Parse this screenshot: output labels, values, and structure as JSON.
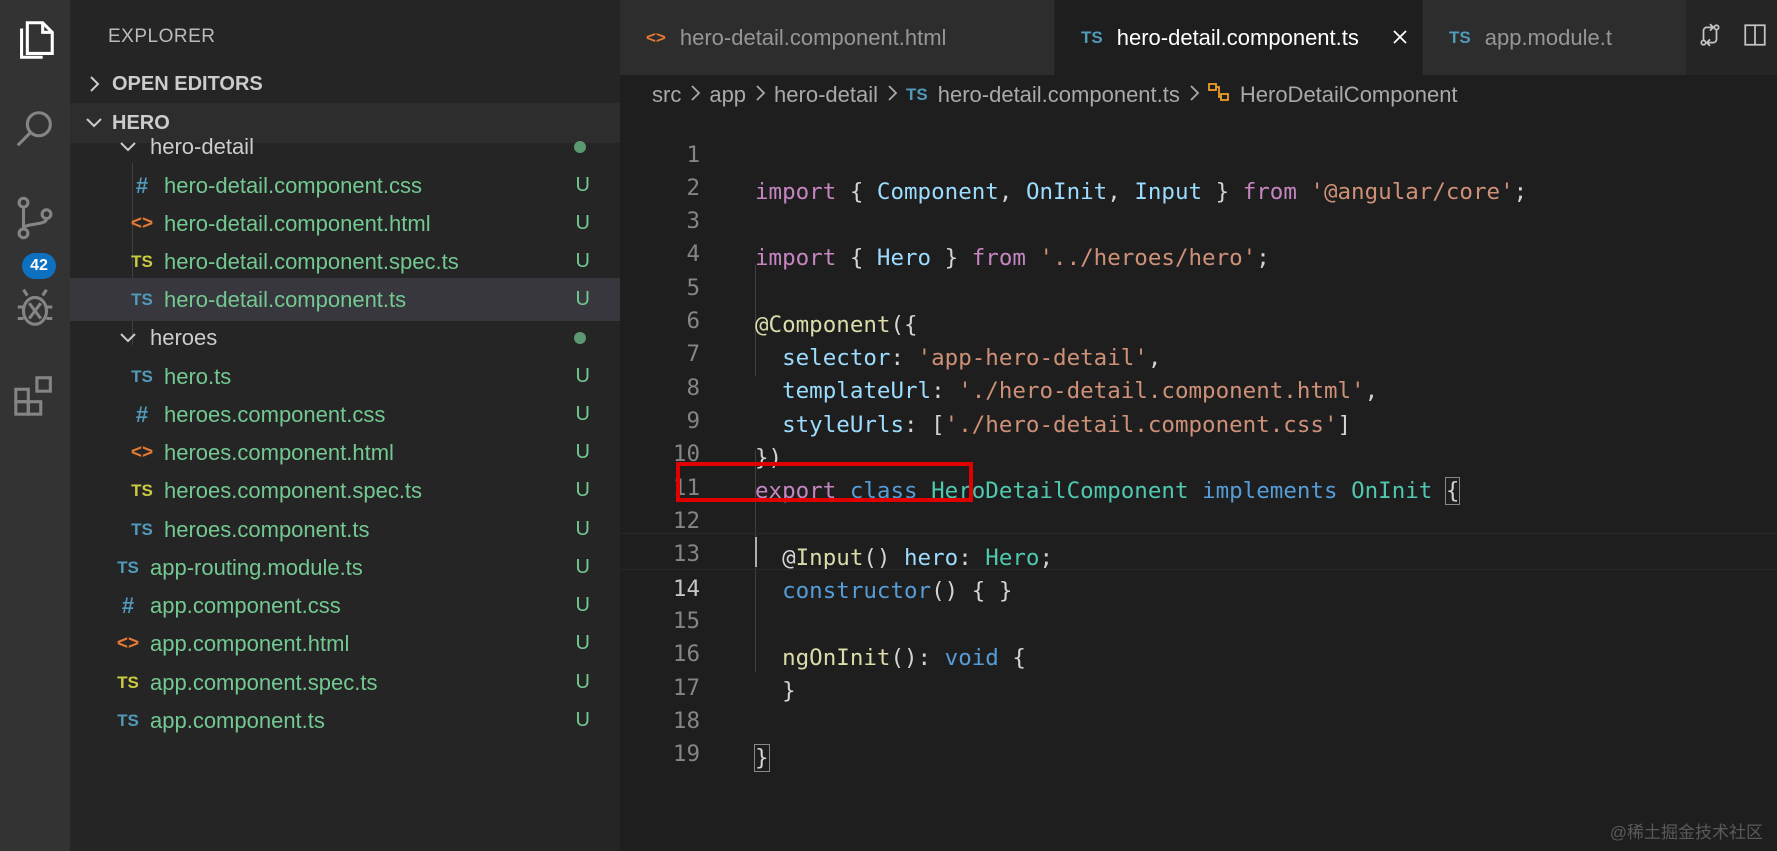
{
  "colors": {
    "activity_bar": "#333333",
    "sidebar": "#252526",
    "editor": "#1e1e1e",
    "git_untracked": "#73c991",
    "badge": "#0e70c0",
    "highlight": "#e00000"
  },
  "activity_bar": {
    "icons": [
      "files-icon",
      "search-icon",
      "source-control-icon",
      "debug-icon",
      "extensions-icon"
    ],
    "source_control_badge": "42"
  },
  "sidebar": {
    "title": "EXPLORER",
    "open_editors": "OPEN EDITORS",
    "workspace": "HERO",
    "items": [
      {
        "label": "hero-detail",
        "type": "folder",
        "status": ""
      },
      {
        "label": "hero-detail.component.css",
        "type": "css",
        "status": "U"
      },
      {
        "label": "hero-detail.component.html",
        "type": "html",
        "status": "U"
      },
      {
        "label": "hero-detail.component.spec.ts",
        "type": "spec",
        "status": "U"
      },
      {
        "label": "hero-detail.component.ts",
        "type": "ts",
        "status": "U"
      },
      {
        "label": "heroes",
        "type": "folder",
        "status": ""
      },
      {
        "label": "hero.ts",
        "type": "ts",
        "status": "U"
      },
      {
        "label": "heroes.component.css",
        "type": "css",
        "status": "U"
      },
      {
        "label": "heroes.component.html",
        "type": "html",
        "status": "U"
      },
      {
        "label": "heroes.component.spec.ts",
        "type": "spec",
        "status": "U"
      },
      {
        "label": "heroes.component.ts",
        "type": "ts",
        "status": "U"
      },
      {
        "label": "app-routing.module.ts",
        "type": "ts",
        "status": "U"
      },
      {
        "label": "app.component.css",
        "type": "css",
        "status": "U"
      },
      {
        "label": "app.component.html",
        "type": "html",
        "status": "U"
      },
      {
        "label": "app.component.spec.ts",
        "type": "spec",
        "status": "U"
      },
      {
        "label": "app.component.ts",
        "type": "ts",
        "status": "U"
      }
    ],
    "icon_glyphs": {
      "ts": "TS",
      "spec": "TS",
      "css": "#",
      "html": "<>"
    }
  },
  "tabs": [
    {
      "label": "hero-detail.component.html",
      "icon": "<>"
    },
    {
      "label": "hero-detail.component.ts",
      "icon": "TS"
    },
    {
      "label": "app.module.t",
      "icon": "TS"
    }
  ],
  "breadcrumb": {
    "parts": [
      "src",
      "app",
      "hero-detail",
      "hero-detail.component.ts",
      "HeroDetailComponent"
    ],
    "ts_icon": "TS"
  },
  "code": {
    "line_numbers": [
      "1",
      "2",
      "3",
      "4",
      "5",
      "6",
      "7",
      "8",
      "9",
      "10",
      "11",
      "12",
      "13",
      "14",
      "15",
      "16",
      "17",
      "18",
      "19"
    ],
    "l1": {
      "k1": "import",
      "p1": " { ",
      "v1": "Component",
      "p2": ", ",
      "v2": "OnInit",
      "p3": ", ",
      "v3": "Input",
      "p4": " } ",
      "k2": "from",
      "p5": " ",
      "s1": "'@angular/core'",
      "p6": ";"
    },
    "l3": {
      "k1": "import",
      "p1": " { ",
      "v1": "Hero",
      "p2": " } ",
      "k2": "from",
      "p3": " ",
      "s1": "'../heroes/hero'",
      "p4": ";"
    },
    "l5": {
      "d": "@",
      "f1": "Component",
      "p1": "({"
    },
    "l6": {
      "ind": "  ",
      "v1": "selector",
      "p1": ": ",
      "s1": "'app-hero-detail'",
      "p2": ","
    },
    "l7": {
      "ind": "  ",
      "v1": "templateUrl",
      "p1": ": ",
      "s1": "'./hero-detail.component.html'",
      "p2": ","
    },
    "l8": {
      "ind": "  ",
      "v1": "styleUrls",
      "p1": ": [",
      "s1": "'./hero-detail.component.css'",
      "p2": "]"
    },
    "l9": {
      "p1": "})"
    },
    "l10": {
      "k1": "export",
      "p1": " ",
      "b1": "class",
      "p2": " ",
      "t1": "HeroDetailComponent",
      "p3": " ",
      "b2": "implements",
      "p4": " ",
      "t2": "OnInit",
      "p5": " ",
      "br": "{"
    },
    "l12": {
      "ind": "  ",
      "p0": "@",
      "f1": "Input",
      "p1": "() ",
      "v1": "hero",
      "p2": ": ",
      "t1": "Hero",
      "p3": ";"
    },
    "l13": {
      "ind": "  ",
      "b1": "constructor",
      "p1": "() { }"
    },
    "l15": {
      "ind": "  ",
      "f1": "ngOnInit",
      "p1": "(): ",
      "b1": "void",
      "p2": " {"
    },
    "l16": {
      "ind": "  ",
      "p1": "}"
    },
    "l18": {
      "br": "}"
    }
  },
  "watermark": "@稀土掘金技术社区"
}
